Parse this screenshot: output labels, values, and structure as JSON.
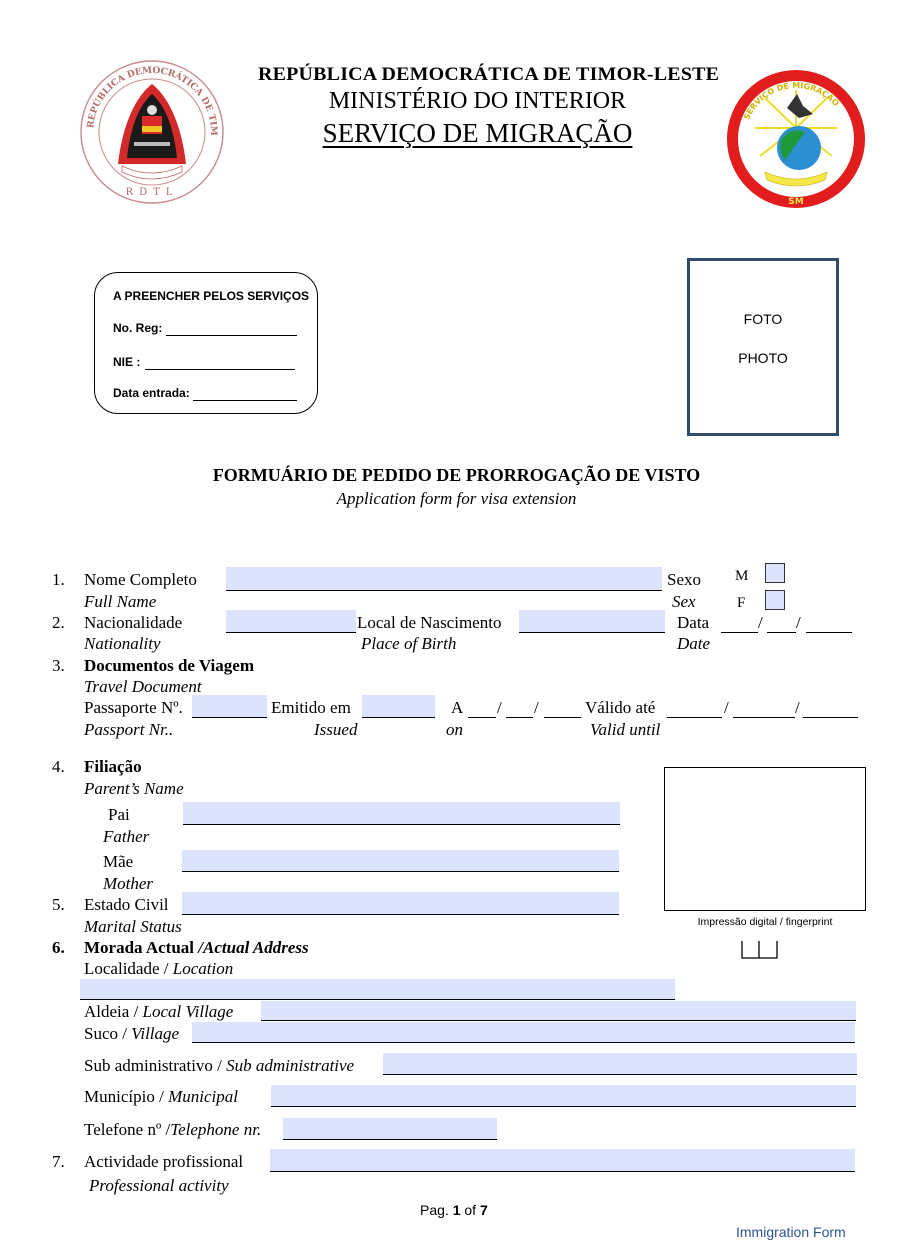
{
  "header": {
    "line1": "REPÚBLICA DEMOCRÁTICA DE TIMOR-LESTE",
    "line2": "MINISTÉRIO DO INTERIOR",
    "line3": "SERVIÇO DE MIGRAÇÃO",
    "left_seal": {
      "icon": "rdtl-seal-icon",
      "ring_text": "REPÚBLICA DEMOCRÁTICA DE TIMOR-LESTE",
      "bottom_text": "R D T L"
    },
    "right_seal": {
      "icon": "migration-service-seal-icon",
      "ring_text": "SERVIÇO DE MIGRAÇÃO",
      "bottom_text": "SM"
    }
  },
  "office_box": {
    "title": "A PREENCHER PELOS SERVIÇOS",
    "fields": [
      {
        "label": "No. Reg:",
        "value": ""
      },
      {
        "label": "NIE :",
        "value": ""
      },
      {
        "label": "Data entrada:",
        "value": ""
      }
    ]
  },
  "photo_box": {
    "label_pt": "FOTO",
    "label_en": "PHOTO"
  },
  "form_title": {
    "pt": "FORMUÁRIO DE PEDIDO DE PRORROGAÇÃO DE VISTO",
    "en": "Application form for visa extension"
  },
  "sections": {
    "s1": {
      "num": "1.",
      "label_pt": "Nome Completo",
      "label_en": "Full Name",
      "value": ""
    },
    "sex": {
      "label_pt": "Sexo",
      "label_en": "Sex",
      "options": [
        {
          "label": "M",
          "checked": false
        },
        {
          "label": "F",
          "checked": false
        }
      ]
    },
    "s2": {
      "num": "2.",
      "label_pt": "Nacionalidade",
      "label_en": "Nationality",
      "value": "",
      "birth_pt": "Local de Nascimento",
      "birth_en": "Place of Birth",
      "birth_value": "",
      "date_pt": "Data",
      "date_en": "Date",
      "date_sep": "/"
    },
    "s3": {
      "num": "3.",
      "label_pt": "Documentos de Viagem",
      "label_en": "Travel Document",
      "passport_pt": "Passaporte Nº.",
      "passport_en": "Passport Nr..",
      "passport_value": "",
      "issued_pt": "Emitido em",
      "issued_en": "Issued",
      "issued_value": "",
      "on_pt": "A",
      "on_en": "on",
      "valid_pt": "Válido até",
      "valid_en": "Valid until",
      "date_sep": "/"
    },
    "s4": {
      "num": "4.",
      "label_pt": "Filiação",
      "label_en": "Parent’s Name",
      "father_pt": "Pai",
      "father_en": "Father",
      "father_value": "",
      "mother_pt": "Mãe",
      "mother_en": "Mother",
      "mother_value": ""
    },
    "s5": {
      "num": "5.",
      "label_pt": "Estado Civil",
      "label_en": "Marital Status",
      "value": ""
    },
    "fingerprint": {
      "label": "Impressão digital / fingerprint"
    },
    "s6": {
      "num": "6.",
      "label_pt": "Morada Actual",
      "label_en": "/Actual Address",
      "location_pt": "Localidade / ",
      "location_en": "Location",
      "location_value": "",
      "aldeia_pt": "Aldeia / ",
      "aldeia_en": "Local Village",
      "aldeia_value": "",
      "suco_pt": "Suco / ",
      "suco_en": "Village",
      "suco_value": "",
      "sub_pt": "Sub administrativo / ",
      "sub_en": "Sub administrative",
      "sub_value": "",
      "mun_pt": "Município / ",
      "mun_en": "Municipal",
      "mun_value": "",
      "tel_pt": "Telefone nº /",
      "tel_en": "Telephone nr.",
      "tel_value": ""
    },
    "s7": {
      "num": "7.",
      "label_pt": "Actividade profissional",
      "label_en": "Professional activity",
      "value": ""
    }
  },
  "footer": {
    "page_prefix": "Pag. ",
    "page_current": "1",
    "page_of": " of ",
    "page_total": "7",
    "form_name": "Immigration Form",
    "form_name_color": "#2f5496"
  }
}
